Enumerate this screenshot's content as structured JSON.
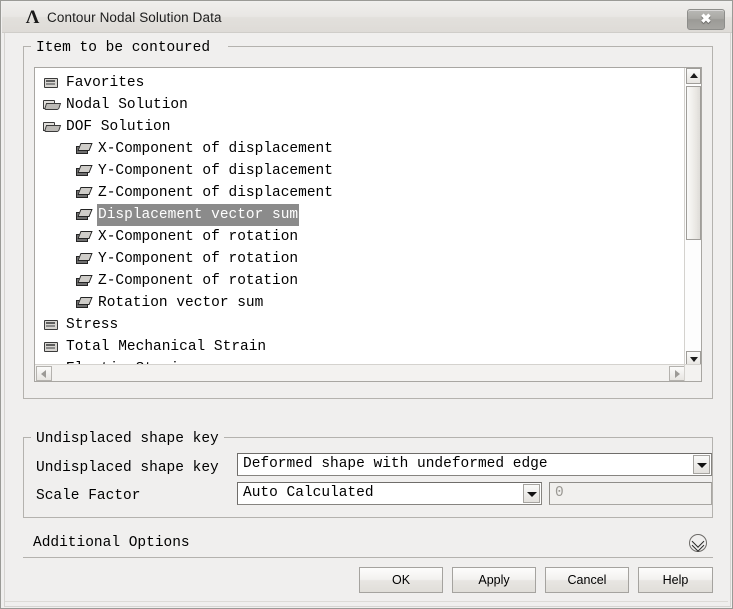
{
  "window": {
    "title": "Contour Nodal Solution Data",
    "logo_glyph": "Λ",
    "close_label": "✖"
  },
  "item_group": {
    "title": "Item to be contoured",
    "tree": [
      {
        "label": "Favorites",
        "icon": "folder-closed-icon",
        "indent": 0,
        "selected": false
      },
      {
        "label": "Nodal Solution",
        "icon": "folder-open-icon",
        "indent": 0,
        "selected": false
      },
      {
        "label": "DOF Solution",
        "icon": "folder-open-icon",
        "indent": 1,
        "selected": false
      },
      {
        "label": "X-Component of displacement",
        "icon": "box-icon",
        "indent": 2,
        "selected": false
      },
      {
        "label": "Y-Component of displacement",
        "icon": "box-icon",
        "indent": 2,
        "selected": false
      },
      {
        "label": "Z-Component of displacement",
        "icon": "box-icon",
        "indent": 2,
        "selected": false
      },
      {
        "label": "Displacement vector sum",
        "icon": "box-icon",
        "indent": 2,
        "selected": true
      },
      {
        "label": "X-Component of rotation",
        "icon": "box-icon",
        "indent": 2,
        "selected": false
      },
      {
        "label": "Y-Component of rotation",
        "icon": "box-icon",
        "indent": 2,
        "selected": false
      },
      {
        "label": "Z-Component of rotation",
        "icon": "box-icon",
        "indent": 2,
        "selected": false
      },
      {
        "label": "Rotation vector sum",
        "icon": "box-icon",
        "indent": 2,
        "selected": false
      },
      {
        "label": "Stress",
        "icon": "folder-closed-icon",
        "indent": 0,
        "selected": false
      },
      {
        "label": "Total Mechanical Strain",
        "icon": "folder-closed-icon",
        "indent": 0,
        "selected": false
      },
      {
        "label": "Elastic Strain",
        "icon": "folder-closed-icon",
        "indent": 0,
        "selected": false
      }
    ]
  },
  "undisplaced_group": {
    "title": "Undisplaced shape key",
    "shape_key_label": "Undisplaced shape key",
    "shape_key_value": "Deformed shape with undeformed edge",
    "scale_factor_label": "Scale Factor",
    "scale_factor_value": "Auto Calculated",
    "scale_factor_number": "0"
  },
  "additional_options": {
    "label": "Additional Options",
    "expander_icon": "chevron-double-down-icon"
  },
  "footer": {
    "ok": "OK",
    "apply": "Apply",
    "cancel": "Cancel",
    "help": "Help"
  },
  "colors": {
    "dialog_background": "#f0efee",
    "list_background": "#ffffff",
    "selection_background": "#8b8b8b",
    "selection_text": "#ffffff",
    "border": "#b4b2ae",
    "disabled_text": "#9a9893"
  }
}
